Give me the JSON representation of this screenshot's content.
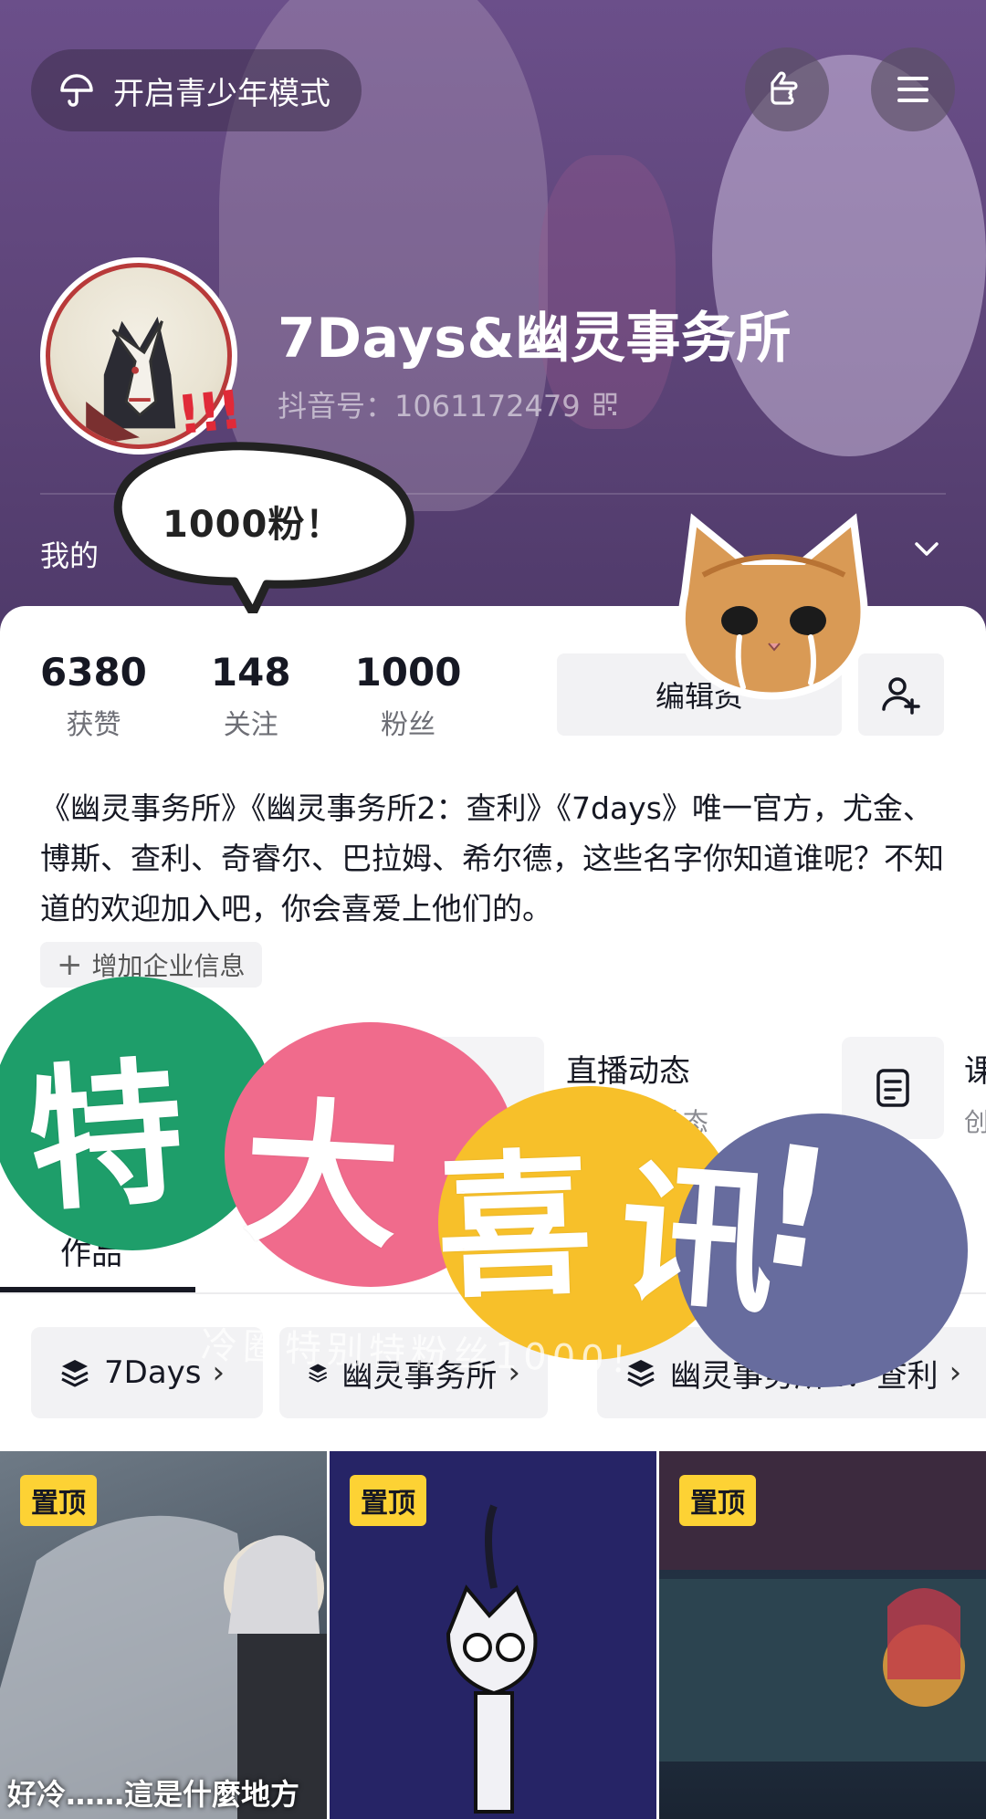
{
  "header": {
    "teen_mode_label": "开启青少年模式",
    "nickname": "7Days&幽灵事务所",
    "douyin_id": "抖音号：1061172479",
    "my_label": "我的"
  },
  "stats": [
    {
      "value": "6380",
      "label": "获赞"
    },
    {
      "value": "148",
      "label": "关注"
    },
    {
      "value": "1000",
      "label": "粉丝"
    }
  ],
  "actions": {
    "edit_profile_label": "编辑资"
  },
  "bio": "《幽灵事务所》《幽灵事务所2：查利》《7days》唯一官方，尤金、博斯、查利、奇睿尔、巴拉姆、希尔德，这些名字你知道谁呢？不知道的欢迎加入吧，你会喜爱上他们的。",
  "enterprise": {
    "label": "增加企业信息"
  },
  "features": {
    "live_title": "直播动态",
    "live_sub": "动态",
    "course_title": "课",
    "course_sub": "创"
  },
  "tabs": {
    "works": "作品"
  },
  "collections": [
    {
      "label": "7Days"
    },
    {
      "label": "幽灵事务所"
    },
    {
      "label": "幽灵事务所2：查利"
    }
  ],
  "videos": [
    {
      "pin_label": "置顶",
      "caption": "好冷……這是什麼地方"
    },
    {
      "pin_label": "置顶",
      "caption": ""
    },
    {
      "pin_label": "置顶",
      "caption": ""
    }
  ],
  "stickers": {
    "bubble_text": "1000粉！",
    "exclaim": "!!!",
    "headline": [
      "特",
      "大",
      "喜",
      "讯",
      "!"
    ],
    "watermark": "冷圈特别特粉丝1000！"
  },
  "colors": {
    "header_bg": "#5d4478",
    "pin_bg": "#fdd234",
    "blob_green": "#1e9e6a",
    "blob_pink": "#f06b8c",
    "blob_yellow": "#f7c02a",
    "blob_slate": "#676c9e"
  }
}
